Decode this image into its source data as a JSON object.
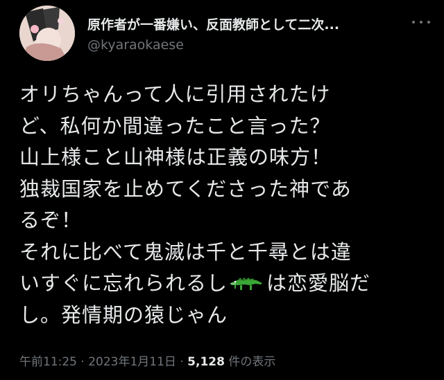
{
  "author": {
    "display_name": "原作者が一番嫌い、反面教師として二次...",
    "handle": "@kyaraokaese",
    "avatar_icon": "profile-avatar"
  },
  "tweet": {
    "lines_before_emoji": [
      "オリちゃんって人に引用されたけ",
      "ど、私何か間違ったこと言った？",
      "山上様こと山神様は正義の味方！",
      "独裁国家を止めてくださった神であ",
      "るぞ！",
      "それに比べて鬼滅は千と千尋とは違"
    ],
    "emoji_line_before": "いすぐに忘れられるし",
    "emoji_name": "crocodile-emoji",
    "emoji_line_after": "は恋愛脳だ",
    "last_line": "し。発情期の猿じゃん"
  },
  "meta": {
    "time": "午前11:25",
    "separator1": " · ",
    "date": "2023年1月11日",
    "separator2": " · ",
    "views_count": "5,128",
    "views_label": " 件の表示"
  },
  "colors": {
    "background": "#000000",
    "primary_text": "#e7e9ea",
    "secondary_text": "#71767b",
    "emoji_green": "#3aa635"
  }
}
